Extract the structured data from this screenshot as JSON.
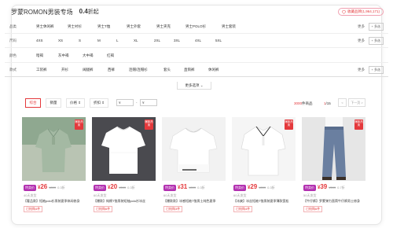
{
  "header": {
    "brand": "罗蒙ROMON男装专场",
    "discount_value": "0.4",
    "discount_suffix": "折起",
    "collect_label": "收藏品牌(1,964,171)"
  },
  "filters": {
    "rows": [
      {
        "label": "品类",
        "options": [
          "男士休闲裤",
          "男士衬衫",
          "男士T恤",
          "男士外套",
          "男士夹克",
          "男士POLO衫",
          "男士套装"
        ],
        "more": "更多",
        "multi": "+ 多选"
      },
      {
        "label": "尺码",
        "options": [
          "4XS",
          "XS",
          "S",
          "M",
          "L",
          "XL",
          "2XL",
          "3XL",
          "4XL",
          "5XL"
        ],
        "more": "更多",
        "multi": "+ 多选"
      },
      {
        "label": "颜色",
        "options": [
          "暗褐",
          "灰中褐",
          "大中褐",
          "红褐"
        ],
        "more": "",
        "multi": ""
      },
      {
        "label": "款式",
        "options": [
          "工装裤",
          "开衫",
          "阔腿裤",
          "西裤",
          "连帽/连帽衫",
          "套头",
          "直筒裤",
          "休闲裤"
        ],
        "more": "更多",
        "multi": "+ 多选"
      }
    ],
    "more_choices": "更多选项 ⌄"
  },
  "sortbar": {
    "default": "综合",
    "sales": "销量",
    "price": "价格 ⇕",
    "discount": "折扣 ⇕",
    "price_min": "¥",
    "price_sep": "-",
    "price_max": "¥",
    "count_number": "3000",
    "count_suffix": "件商品",
    "page_current": "1",
    "page_total": "/15",
    "prev": "<",
    "next": "下一页 >"
  },
  "products": [
    {
      "tag": "特卖价",
      "price": "26",
      "orig": "¥899",
      "disc": "0.3折",
      "sub": "40天发货",
      "title": "【奢品款】短袖polo衫男装夏季休闲修身",
      "sold": "已抢购4件",
      "badge": "爆款热卖",
      "colors": {
        "bg": "#8fa890",
        "shirt": "#9db59f"
      }
    },
    {
      "tag": "特卖价",
      "price": "20",
      "orig": "¥599",
      "disc": "0.3折",
      "sub": "60天发货",
      "title": "【爆款】纯棉T恤男装短袖polo衫冰丝",
      "sold": "已抢购6件",
      "badge": "爆款热卖",
      "colors": {
        "bg": "#4a4a4f",
        "shirt": "#ffffff"
      }
    },
    {
      "tag": "特卖价",
      "price": "31",
      "orig": "¥899",
      "disc": "0.3折",
      "sub": "60天发货",
      "title": "【爆款款】冰感短袖T恤男士纯色夏季",
      "sold": "已抢购3件",
      "badge": "",
      "colors": {
        "bg": "#f2f2f2",
        "shirt": "#ffffff"
      }
    },
    {
      "tag": "特卖价",
      "price": "29",
      "orig": "¥899",
      "disc": "0.3折",
      "sub": "60天发货",
      "title": "【冰爽】冰丝短袖T恤男装夏季薄款宽松",
      "sold": "已抢购4件",
      "badge": "爆款热卖",
      "colors": {
        "bg": "#f5f5f5",
        "shirt": "#ffffff"
      }
    },
    {
      "tag": "特卖价",
      "price": "39",
      "orig": "¥599",
      "disc": "0.7折",
      "sub": "50天发货",
      "title": "【牛仔裤】罗蒙弹力直筒牛仔裤男士修身",
      "sold": "已抢购6件",
      "badge": "爆款热卖",
      "colors": {
        "bg": "#e6e6e6",
        "shirt": "#6a7fa0"
      }
    }
  ]
}
